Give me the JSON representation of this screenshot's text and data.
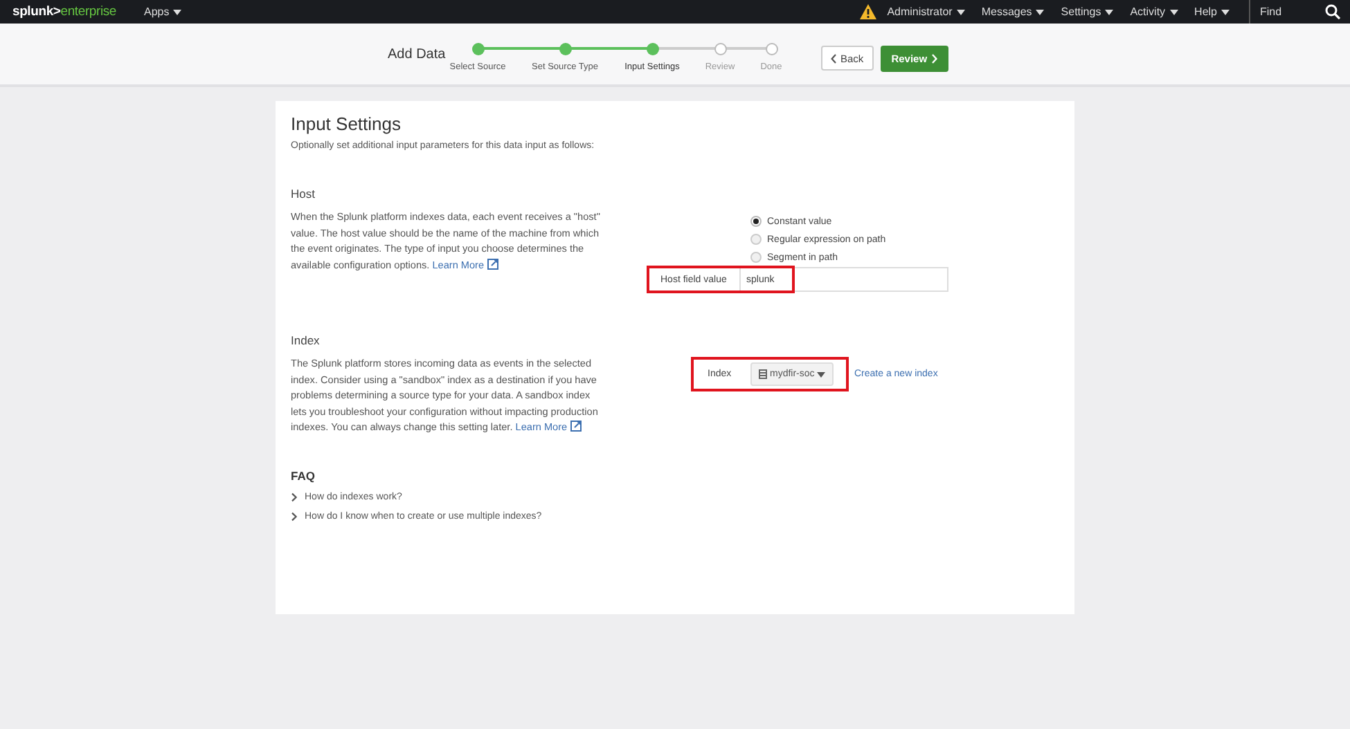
{
  "logo": {
    "brand": "splunk>",
    "product": "enterprise"
  },
  "nav": {
    "apps": "Apps",
    "menus": [
      {
        "label": "Administrator"
      },
      {
        "label": "Messages"
      },
      {
        "label": "Settings"
      },
      {
        "label": "Activity"
      },
      {
        "label": "Help"
      }
    ],
    "search": {
      "placeholder": "Find"
    },
    "warning": true
  },
  "wizard": {
    "title": "Add Data",
    "steps": [
      {
        "label": "Select Source",
        "completed": true,
        "selected": false
      },
      {
        "label": "Set Source Type",
        "completed": true,
        "selected": false
      },
      {
        "label": "Input Settings",
        "completed": true,
        "selected": true
      },
      {
        "label": "Review",
        "completed": false,
        "selected": false
      },
      {
        "label": "Done",
        "completed": false,
        "selected": false
      }
    ],
    "back": "Back",
    "next": "Review"
  },
  "page": {
    "title": "Input Settings",
    "subtitle": "Optionally set additional input parameters for this data input as follows:"
  },
  "host": {
    "heading": "Host",
    "description": "When the Splunk platform indexes data, each event receives a \"host\" value. The host value should be the name of the machine from which the event originates. The type of input you choose determines the available configuration options.",
    "learn_more": "Learn More",
    "options": [
      {
        "label": "Constant value",
        "selected": true
      },
      {
        "label": "Regular expression on path",
        "selected": false
      },
      {
        "label": "Segment in path",
        "selected": false
      }
    ],
    "field": {
      "label": "Host field value",
      "value": "splunk",
      "highlighted": true
    }
  },
  "index": {
    "heading": "Index",
    "description": "The Splunk platform stores incoming data as events in the selected index. Consider using a \"sandbox\" index as a destination if you have problems determining a source type for your data. A sandbox index lets you troubleshoot your configuration without impacting production indexes. You can always change this setting later.",
    "learn_more": "Learn More",
    "field": {
      "label": "Index",
      "value": "mydfir-soc",
      "highlighted": true
    },
    "create_link": "Create a new index"
  },
  "faq": {
    "heading": "FAQ",
    "items": [
      {
        "label": "How do indexes work?",
        "expanded": false
      },
      {
        "label": "How do I know when to create or use multiple indexes?",
        "expanded": false
      }
    ]
  }
}
